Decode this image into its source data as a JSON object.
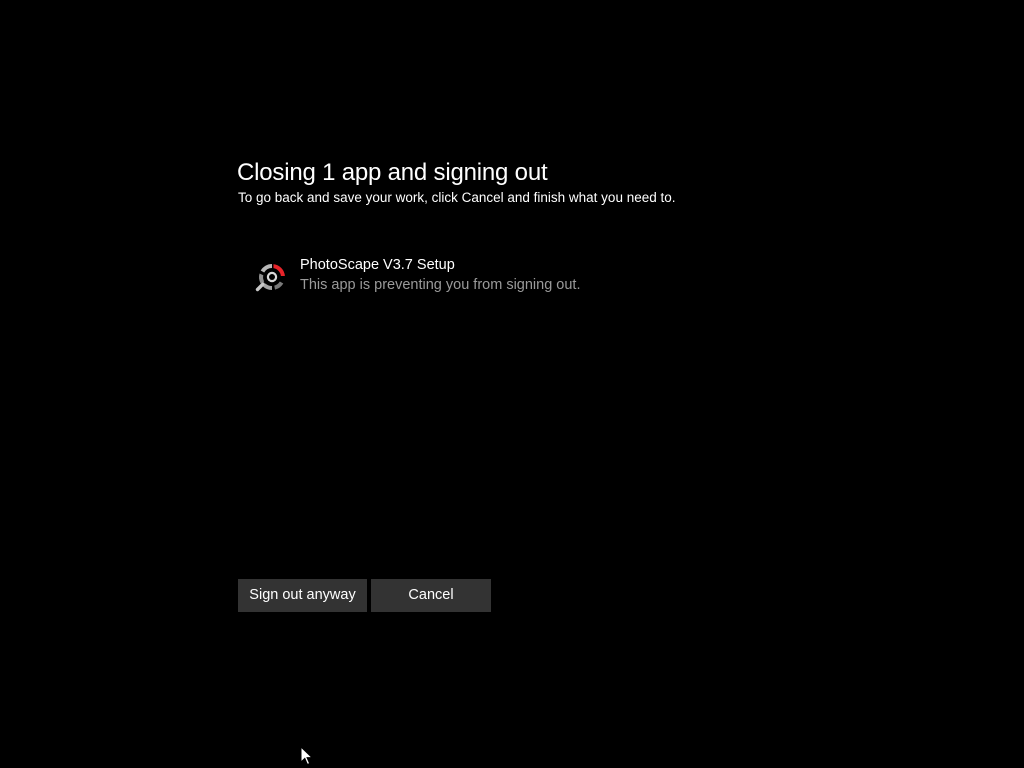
{
  "dialog": {
    "title": "Closing 1 app and signing out",
    "subtitle": "To go back and save your work, click Cancel and finish what you need to."
  },
  "apps": [
    {
      "name": "PhotoScape V3.7 Setup",
      "status": "This app is preventing you from signing out.",
      "icon": "photoscape-icon"
    }
  ],
  "buttons": {
    "sign_out_label": "Sign out anyway",
    "cancel_label": "Cancel"
  },
  "colors": {
    "background": "#000000",
    "button_bg": "#333333",
    "text_primary": "#ffffff",
    "text_secondary": "#9a9a9a",
    "icon_accent": "#e8242a"
  }
}
